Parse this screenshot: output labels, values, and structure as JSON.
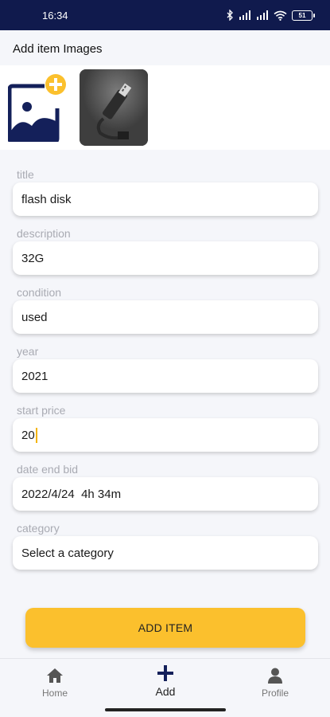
{
  "status_bar": {
    "time": "16:34",
    "battery": "51",
    "icons": [
      "bluetooth-icon",
      "signal-icon",
      "signal-icon",
      "wifi-icon",
      "battery-icon"
    ]
  },
  "images": {
    "header": "Add item Images",
    "add_icon": "add-image-icon",
    "photo_icon": "usb-flash-drive-photo"
  },
  "form": {
    "fields": [
      {
        "label": "title",
        "value": "flash disk"
      },
      {
        "label": "description",
        "value": "32G"
      },
      {
        "label": "condition",
        "value": "used"
      },
      {
        "label": "year",
        "value": "2021"
      },
      {
        "label": "start price",
        "value": "20"
      },
      {
        "label": "date end bid",
        "value": "2022/4/24  4h 34m"
      },
      {
        "label": "category",
        "value": "Select a category"
      }
    ]
  },
  "submit_label": "ADD ITEM",
  "nav": {
    "items": [
      {
        "label": "Home",
        "icon": "home-icon"
      },
      {
        "label": "Add",
        "icon": "plus-icon"
      },
      {
        "label": "Profile",
        "icon": "person-icon"
      }
    ]
  },
  "colors": {
    "status_bar": "#101a4d",
    "accent": "#fbc02d",
    "navy": "#14205a"
  }
}
